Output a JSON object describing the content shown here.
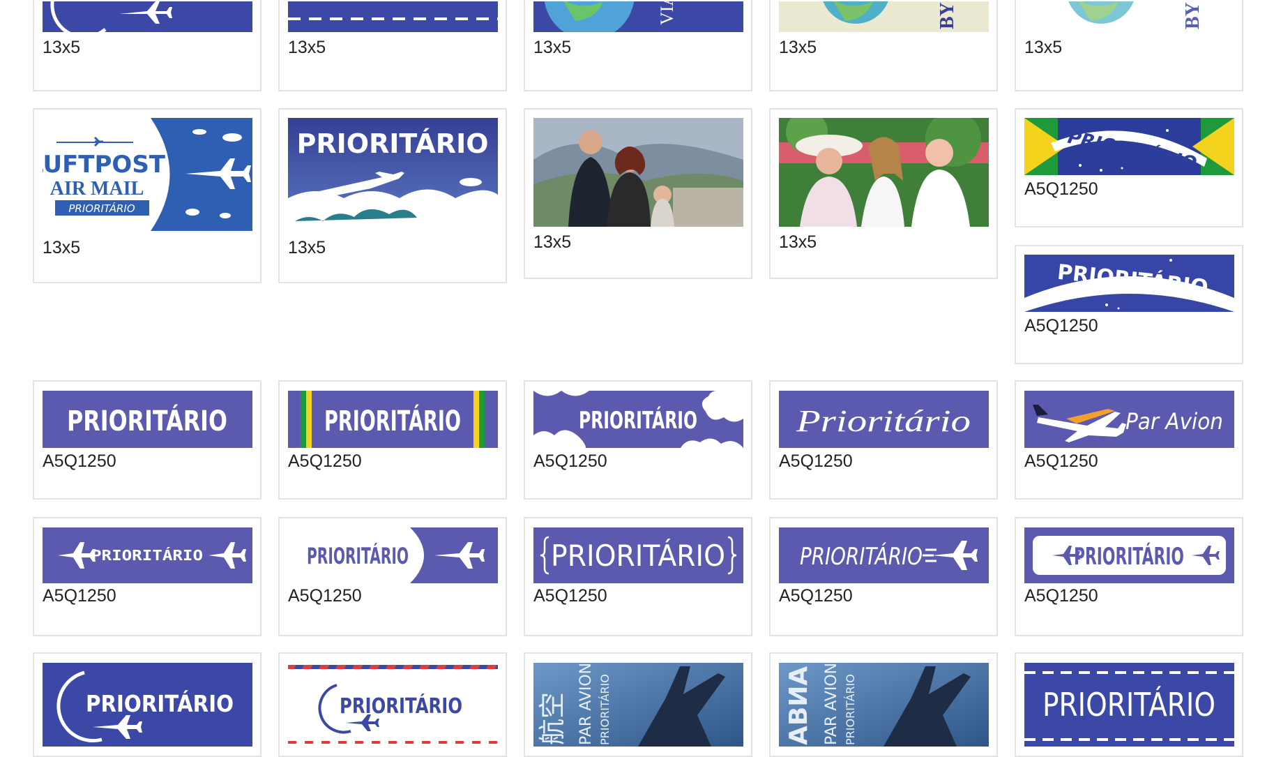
{
  "gallery": {
    "row1": [
      {
        "caption": "13x5",
        "art": "circle-plane"
      },
      {
        "caption": "13x5",
        "art": "dashed-stripe"
      },
      {
        "caption": "13x5",
        "art": "globe-viagem",
        "text": "VIA San"
      },
      {
        "caption": "13x5",
        "art": "globe-bym",
        "text": "BY M"
      },
      {
        "caption": "13x5",
        "art": "globe-bym-light",
        "text": "BY M"
      }
    ],
    "row2": [
      {
        "caption": "13x5",
        "art": "luftpost",
        "lines": [
          "LUFTPOST",
          "AIR MAIL",
          "PRIORITÁRIO"
        ]
      },
      {
        "caption": "13x5",
        "art": "prioritario-clouds",
        "text": "PRIORITÁRIO"
      },
      {
        "caption": "13x5",
        "art": "family-photo-mountains"
      },
      {
        "caption": "13x5",
        "art": "family-photo-garden"
      },
      {
        "caption": "A5Q1250",
        "art": "brazil-flag",
        "text": "PRIORITÁRIO"
      }
    ],
    "side": {
      "caption": "A5Q1250",
      "art": "arc-stars",
      "text": "PRIORITÁRIO"
    },
    "row3": [
      {
        "caption": "A5Q1250",
        "art": "plain-bold",
        "text": "PRIORITÁRIO"
      },
      {
        "caption": "A5Q1250",
        "art": "green-yellow-bars",
        "text": "PRIORITÁRIO"
      },
      {
        "caption": "A5Q1250",
        "art": "cloud-edges",
        "text": "PRIORITÁRIO"
      },
      {
        "caption": "A5Q1250",
        "art": "script",
        "text": "Prioritário"
      },
      {
        "caption": "A5Q1250",
        "art": "par-avion",
        "text": "Par Avion"
      }
    ],
    "row4": [
      {
        "caption": "A5Q1250",
        "art": "planes-both-sides",
        "text": "PRIORITÁRIO"
      },
      {
        "caption": "A5Q1250",
        "art": "arrow-plane",
        "text": "PRIORITÁRIO"
      },
      {
        "caption": "A5Q1250",
        "art": "bracket-frame",
        "text": "PRIORITÁRIO"
      },
      {
        "caption": "A5Q1250",
        "art": "italic-plane",
        "text": "PRIORITÁRIO"
      },
      {
        "caption": "A5Q1250",
        "art": "white-pill",
        "text": "PRIORITÁRIO"
      }
    ],
    "row5": [
      {
        "art": "circle-plane-text",
        "text": "PRIORITÁRIO"
      },
      {
        "art": "airmail-border",
        "text": "PRIORITÁRIO"
      },
      {
        "art": "jet-photo-chinese",
        "lines": [
          "航空",
          "PAR AVION",
          "PRIORITÁRIO"
        ]
      },
      {
        "art": "jet-photo-cyrillic",
        "lines": [
          "АВИА",
          "PAR AVION",
          "PRIORITÁRIO"
        ]
      },
      {
        "art": "dashed-border-text",
        "text": "PRIORITÁRIO"
      }
    ]
  },
  "colors": {
    "blue": "#3c48a6",
    "purple": "#5b5aae",
    "border": "#e3e3e3",
    "green": "#1f9a3a",
    "yellow": "#f4d31e"
  }
}
